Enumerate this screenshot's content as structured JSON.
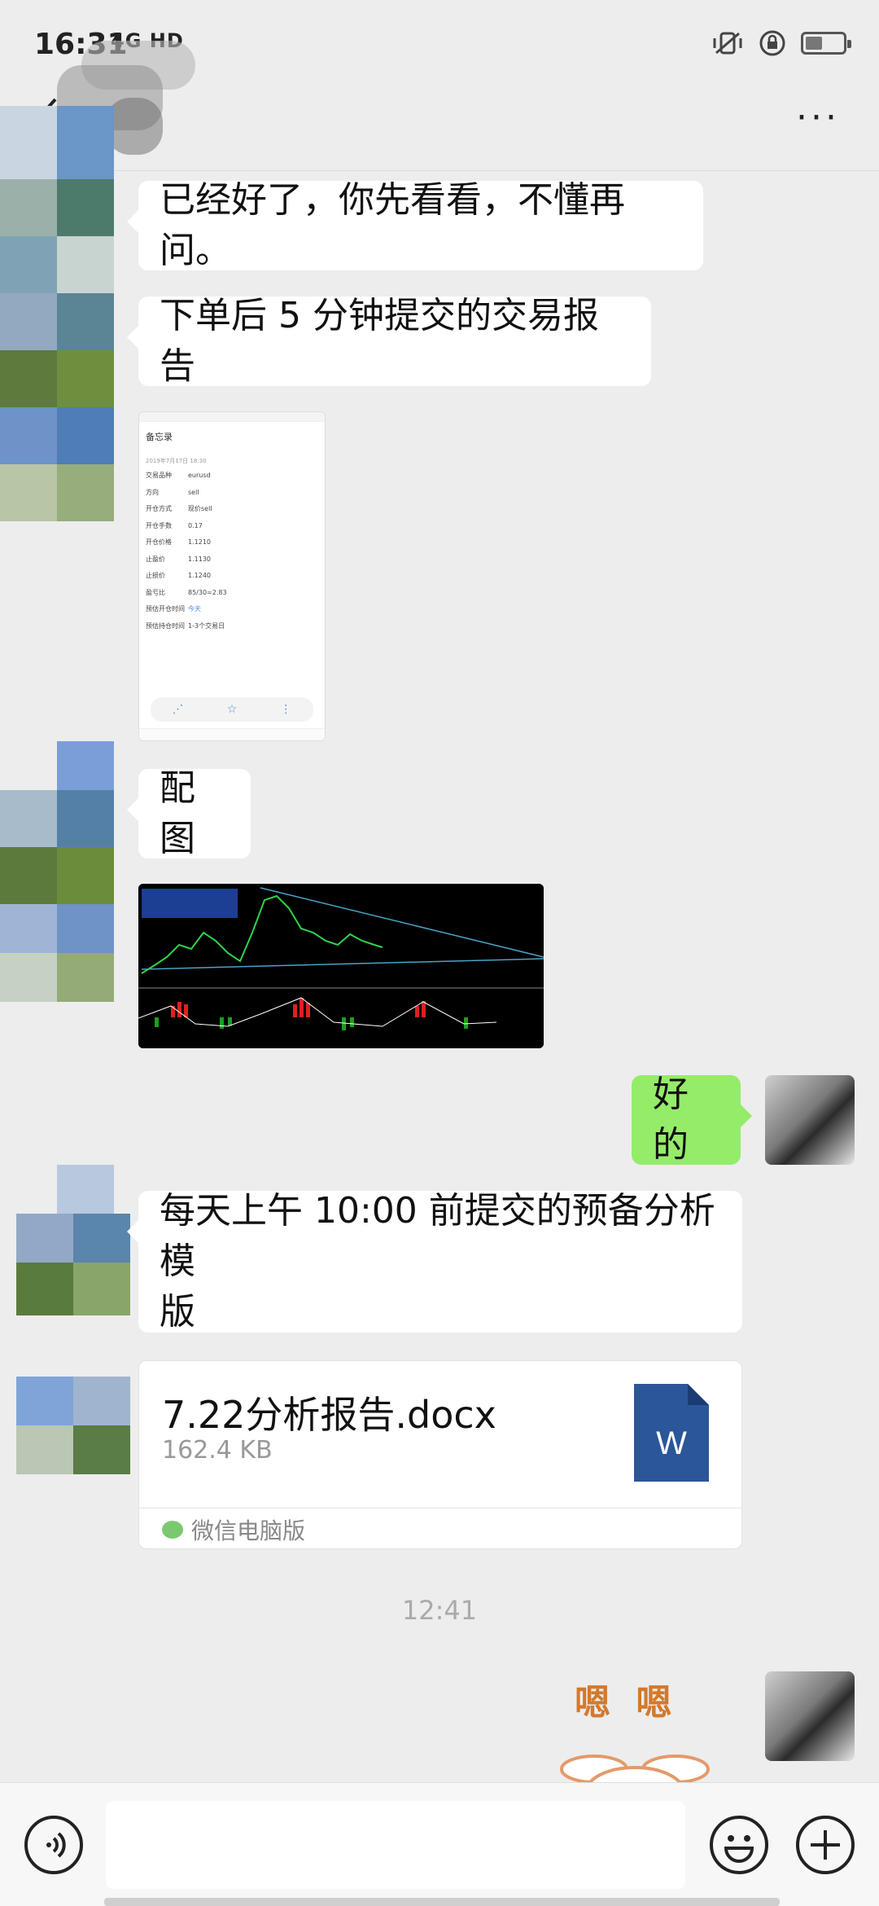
{
  "status": {
    "time": "16:31",
    "network": "4G HD"
  },
  "header": {
    "more": "···"
  },
  "messages": {
    "m1": "已经好了，你先看看，不懂再问。",
    "m2": "下单后 5 分钟提交的交易报告",
    "m3": "配图",
    "m4": "好的",
    "m5_line1": "每天上午 10:00 前提交的预备分析模",
    "m5_line2": "版"
  },
  "screenshot_thumb": {
    "app_title": "备忘录",
    "date": "2019年7月17日 18:30",
    "rows": [
      {
        "k": "交易品种",
        "v": "eurusd"
      },
      {
        "k": "方向",
        "v": "sell"
      },
      {
        "k": "开仓方式",
        "v": "现价sell"
      },
      {
        "k": "开仓手数",
        "v": "0.17"
      },
      {
        "k": "开仓价格",
        "v": "1.1210"
      },
      {
        "k": "止盈价",
        "v": "1.1130"
      },
      {
        "k": "止损价",
        "v": "1.1240"
      },
      {
        "k": "盈亏比",
        "v": "85/30=2.83"
      },
      {
        "k": "预估开仓时间",
        "v": "今天"
      },
      {
        "k": "预估持仓时间",
        "v": "1-3个交易日"
      }
    ],
    "bottom_actions": [
      "分享",
      "收藏",
      "更多"
    ]
  },
  "file": {
    "name": "7.22分析报告.docx",
    "size": "162.4 KB",
    "source": "微信电脑版",
    "icon_letter": "W"
  },
  "timestamp": "12:41",
  "sticker_text": "嗯 嗯",
  "colors": {
    "my_bubble": "#95ec69",
    "word_blue": "#2b579a",
    "background": "#ededed"
  }
}
